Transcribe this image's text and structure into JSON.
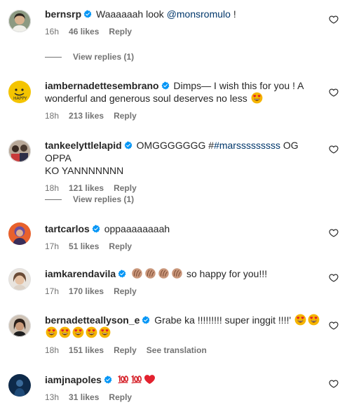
{
  "comments": [
    {
      "user": "bernsrp",
      "pre": "Waaaaaah look ",
      "mention": "@monsromulo",
      "post": " !",
      "emojis": [],
      "time": "16h",
      "likes": "46 likes",
      "reply": "Reply",
      "view_replies": "View replies (1)"
    },
    {
      "user": "iambernadettesembrano",
      "line1": "Dimps— I wish this for you ! A",
      "line2": "wonderful and generous soul deserves no less",
      "time": "18h",
      "likes": "213 likes",
      "reply": "Reply"
    },
    {
      "user": "tankeelyttlelapid",
      "pre": "OMGGGGGGG #",
      "mention": "#marsssssssss",
      "post": " OG OPPA",
      "line2": "KO YANNNNNNN",
      "time": "18h",
      "likes": "121 likes",
      "reply": "Reply",
      "view_replies": "View replies (1)"
    },
    {
      "user": "tartcarlos",
      "text": "oppaaaaaaaah",
      "time": "17h",
      "likes": "51 likes",
      "reply": "Reply"
    },
    {
      "user": "iamkarendavila",
      "text": "so happy for you!!!",
      "time": "17h",
      "likes": "170 likes",
      "reply": "Reply"
    },
    {
      "user": "bernadetteallyson_e",
      "text": "Grabe ka !!!!!!!!! super inggit !!!!'",
      "time": "18h",
      "likes": "151 likes",
      "reply": "Reply",
      "translate": "See translation"
    },
    {
      "user": "iamjnapoles",
      "text": "",
      "time": "13h",
      "likes": "31 likes",
      "reply": "Reply"
    }
  ],
  "icons": {
    "verified": "verified-badge-icon",
    "like": "heart-outline-icon",
    "accent": "#0095f6",
    "mention_color": "#00376b"
  }
}
